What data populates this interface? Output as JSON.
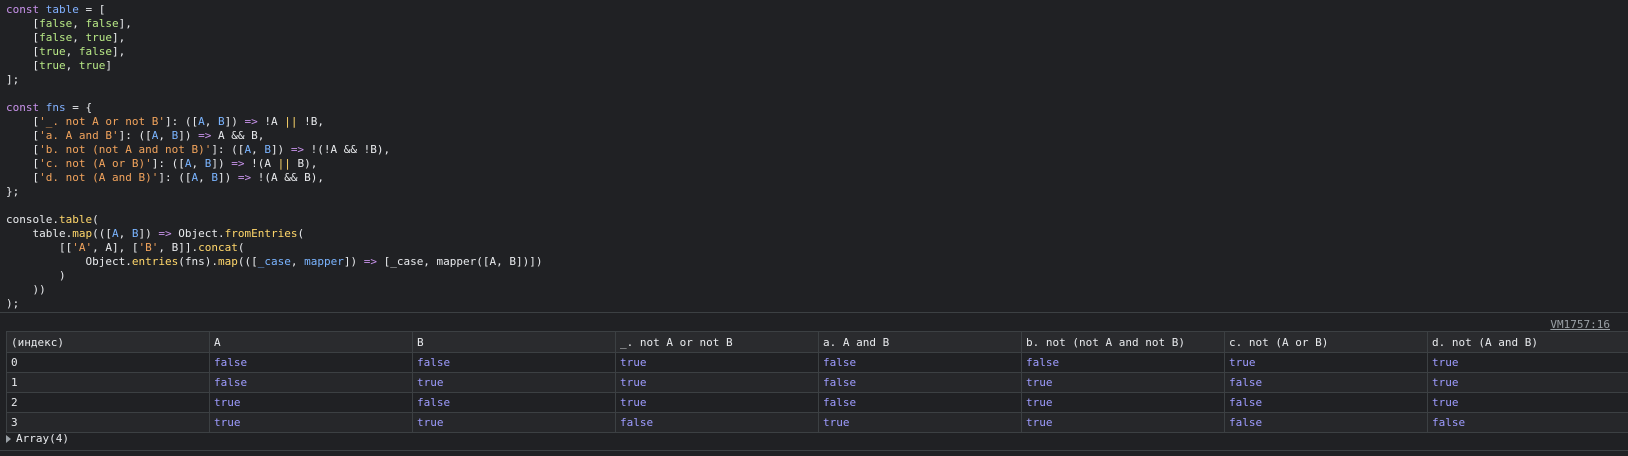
{
  "code_lines": [
    [
      [
        "kw",
        "const "
      ],
      [
        "var",
        "table"
      ],
      [
        "plain",
        " = ["
      ]
    ],
    [
      [
        "plain",
        "    ["
      ],
      [
        "lit",
        "false"
      ],
      [
        "plain",
        ", "
      ],
      [
        "lit",
        "false"
      ],
      [
        "plain",
        "],"
      ]
    ],
    [
      [
        "plain",
        "    ["
      ],
      [
        "lit",
        "false"
      ],
      [
        "plain",
        ", "
      ],
      [
        "lit",
        "true"
      ],
      [
        "plain",
        "],"
      ]
    ],
    [
      [
        "plain",
        "    ["
      ],
      [
        "lit",
        "true"
      ],
      [
        "plain",
        ", "
      ],
      [
        "lit",
        "false"
      ],
      [
        "plain",
        "],"
      ]
    ],
    [
      [
        "plain",
        "    ["
      ],
      [
        "lit",
        "true"
      ],
      [
        "plain",
        ", "
      ],
      [
        "lit",
        "true"
      ],
      [
        "plain",
        "]"
      ]
    ],
    [
      [
        "plain",
        "];"
      ]
    ],
    [
      [
        "plain",
        ""
      ]
    ],
    [
      [
        "kw",
        "const "
      ],
      [
        "var",
        "fns"
      ],
      [
        "plain",
        " = {"
      ]
    ],
    [
      [
        "plain",
        "    ["
      ],
      [
        "str",
        "'_. not A or not B'"
      ],
      [
        "plain",
        "]: (["
      ],
      [
        "param",
        "A"
      ],
      [
        "plain",
        ", "
      ],
      [
        "param",
        "B"
      ],
      [
        "plain",
        "]) "
      ],
      [
        "arrow",
        "=>"
      ],
      [
        "plain",
        " !A "
      ],
      [
        "fn",
        "||"
      ],
      [
        "plain",
        " !B,"
      ]
    ],
    [
      [
        "plain",
        "    ["
      ],
      [
        "str",
        "'a. A and B'"
      ],
      [
        "plain",
        "]: (["
      ],
      [
        "param",
        "A"
      ],
      [
        "plain",
        ", "
      ],
      [
        "param",
        "B"
      ],
      [
        "plain",
        "]) "
      ],
      [
        "arrow",
        "=>"
      ],
      [
        "plain",
        " A && B,"
      ]
    ],
    [
      [
        "plain",
        "    ["
      ],
      [
        "str",
        "'b. not (not A and not B)'"
      ],
      [
        "plain",
        "]: (["
      ],
      [
        "param",
        "A"
      ],
      [
        "plain",
        ", "
      ],
      [
        "param",
        "B"
      ],
      [
        "plain",
        "]) "
      ],
      [
        "arrow",
        "=>"
      ],
      [
        "plain",
        " !(!A && !B),"
      ]
    ],
    [
      [
        "plain",
        "    ["
      ],
      [
        "str",
        "'c. not (A or B)'"
      ],
      [
        "plain",
        "]: (["
      ],
      [
        "param",
        "A"
      ],
      [
        "plain",
        ", "
      ],
      [
        "param",
        "B"
      ],
      [
        "plain",
        "]) "
      ],
      [
        "arrow",
        "=>"
      ],
      [
        "plain",
        " !(A "
      ],
      [
        "fn",
        "||"
      ],
      [
        "plain",
        " B),"
      ]
    ],
    [
      [
        "plain",
        "    ["
      ],
      [
        "str",
        "'d. not (A and B)'"
      ],
      [
        "plain",
        "]: (["
      ],
      [
        "param",
        "A"
      ],
      [
        "plain",
        ", "
      ],
      [
        "param",
        "B"
      ],
      [
        "plain",
        "]) "
      ],
      [
        "arrow",
        "=>"
      ],
      [
        "plain",
        " !(A && B),"
      ]
    ],
    [
      [
        "plain",
        "};"
      ]
    ],
    [
      [
        "plain",
        ""
      ]
    ],
    [
      [
        "plain",
        "console."
      ],
      [
        "fn",
        "table"
      ],
      [
        "plain",
        "("
      ]
    ],
    [
      [
        "plain",
        "    table."
      ],
      [
        "fn",
        "map"
      ],
      [
        "plain",
        "((["
      ],
      [
        "param",
        "A"
      ],
      [
        "plain",
        ", "
      ],
      [
        "param",
        "B"
      ],
      [
        "plain",
        "]) "
      ],
      [
        "arrow",
        "=>"
      ],
      [
        "plain",
        " Object."
      ],
      [
        "fn",
        "fromEntries"
      ],
      [
        "plain",
        "("
      ]
    ],
    [
      [
        "plain",
        "        [["
      ],
      [
        "str",
        "'A'"
      ],
      [
        "plain",
        ", A], ["
      ],
      [
        "str",
        "'B'"
      ],
      [
        "plain",
        ", B]]."
      ],
      [
        "fn",
        "concat"
      ],
      [
        "plain",
        "("
      ]
    ],
    [
      [
        "plain",
        "            Object."
      ],
      [
        "fn",
        "entries"
      ],
      [
        "plain",
        "(fns)."
      ],
      [
        "fn",
        "map"
      ],
      [
        "plain",
        "((["
      ],
      [
        "param",
        "_case"
      ],
      [
        "plain",
        ", "
      ],
      [
        "param",
        "mapper"
      ],
      [
        "plain",
        "]) "
      ],
      [
        "arrow",
        "=>"
      ],
      [
        "plain",
        " [_case, mapper([A, B])])"
      ]
    ],
    [
      [
        "plain",
        "        )"
      ]
    ],
    [
      [
        "plain",
        "    ))"
      ]
    ],
    [
      [
        "plain",
        ");"
      ]
    ]
  ],
  "source_link": "VM1757:16",
  "table": {
    "headers": [
      "(индекс)",
      "A",
      "B",
      "_. not A or not B",
      "a. A and B",
      "b. not (not A and not B)",
      "c. not (A or B)",
      "d. not (A and B)"
    ],
    "rows": [
      [
        "0",
        "false",
        "false",
        "true",
        "false",
        "false",
        "true",
        "true"
      ],
      [
        "1",
        "false",
        "true",
        "true",
        "false",
        "true",
        "false",
        "true"
      ],
      [
        "2",
        "true",
        "false",
        "true",
        "false",
        "true",
        "false",
        "true"
      ],
      [
        "3",
        "true",
        "true",
        "false",
        "true",
        "true",
        "false",
        "false"
      ]
    ]
  },
  "array_summary": "Array(4)",
  "icons": {
    "expand": "triangle-right-icon"
  }
}
